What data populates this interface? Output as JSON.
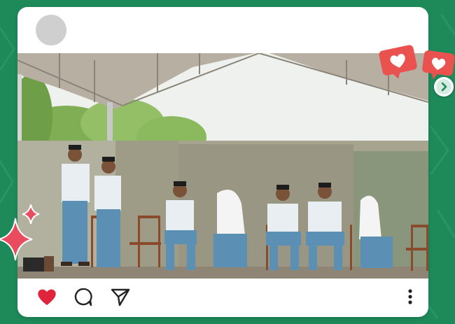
{
  "colors": {
    "background": "#1e8a5a",
    "card": "#ffffff",
    "like_heart": "#e0243b",
    "notification_badge": "#e9524f",
    "sparkle": "#e94c5e"
  },
  "post": {
    "avatar": "avatar-placeholder",
    "photo": "students-on-stage-photo"
  },
  "actions": {
    "like_icon": "heart-icon",
    "comment_icon": "comment-icon",
    "share_icon": "send-icon",
    "more_icon": "more-vertical-icon"
  },
  "decorations": {
    "badges": [
      "heart-badge-icon",
      "heart-badge-icon"
    ],
    "next_icon": "chevron-right-icon",
    "sparkle_icon": "sparkle-icon"
  }
}
